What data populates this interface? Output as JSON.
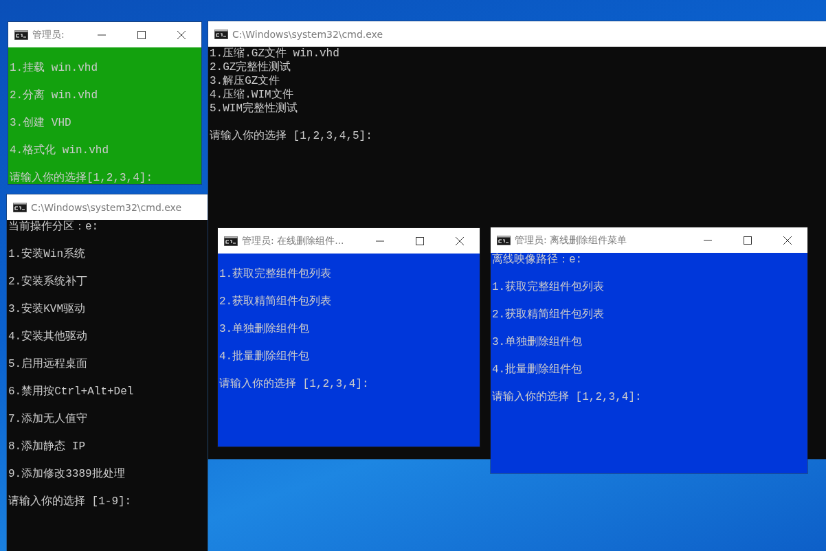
{
  "windows": [
    {
      "kind": "spaced",
      "title": "管理员:",
      "color": "#13a10e",
      "has_controls": true,
      "leading_blank": true,
      "lines": [
        "1.挂载 win.vhd",
        "2.分离 win.vhd",
        "3.创建 VHD",
        "4.格式化 win.vhd"
      ],
      "prompt": "请输入你的选择[1,2,3,4]:"
    },
    {
      "kind": "compact",
      "title": "C:\\Windows\\system32\\cmd.exe",
      "color": "#0c0c0c",
      "has_controls": false,
      "leading_blank": false,
      "lines": [
        "1.压缩.GZ文件 win.vhd",
        "2.GZ完整性测试",
        "3.解压GZ文件",
        "4.压缩.WIM文件",
        "5.WIM完整性测试"
      ],
      "prompt": "请输入你的选择 [1,2,3,4,5]:"
    },
    {
      "kind": "spaced",
      "title": "C:\\Windows\\system32\\cmd.exe",
      "color": "#0c0c0c",
      "has_controls": false,
      "leading_blank": false,
      "lines": [
        "当前操作分区：e:",
        "1.安装Win系统",
        "2.安装系统补丁",
        "3.安装KVM驱动",
        "4.安装其他驱动",
        "5.启用远程桌面",
        "6.禁用按Ctrl+Alt+Del",
        "7.添加无人值守",
        "8.添加静态 IP",
        "9.添加修改3389批处理"
      ],
      "prompt": "请输入你的选择 [1-9]:"
    },
    {
      "kind": "spaced",
      "title": "管理员:  在线删除组件...",
      "color": "#0037da",
      "has_controls": true,
      "leading_blank": true,
      "lines": [
        "1.获取完整组件包列表",
        "2.获取精简组件包列表",
        "3.单独删除组件包",
        "4.批量删除组件包"
      ],
      "prompt": "请输入你的选择 [1,2,3,4]:"
    },
    {
      "kind": "spaced",
      "title": "管理员:  离线删除组件菜单",
      "color": "#0037da",
      "has_controls": true,
      "leading_blank": false,
      "lines": [
        "离线映像路径：e:",
        "1.获取完整组件包列表",
        "2.获取精简组件包列表",
        "3.单独删除组件包",
        "4.批量删除组件包"
      ],
      "prompt": "请输入你的选择 [1,2,3,4]:"
    }
  ]
}
